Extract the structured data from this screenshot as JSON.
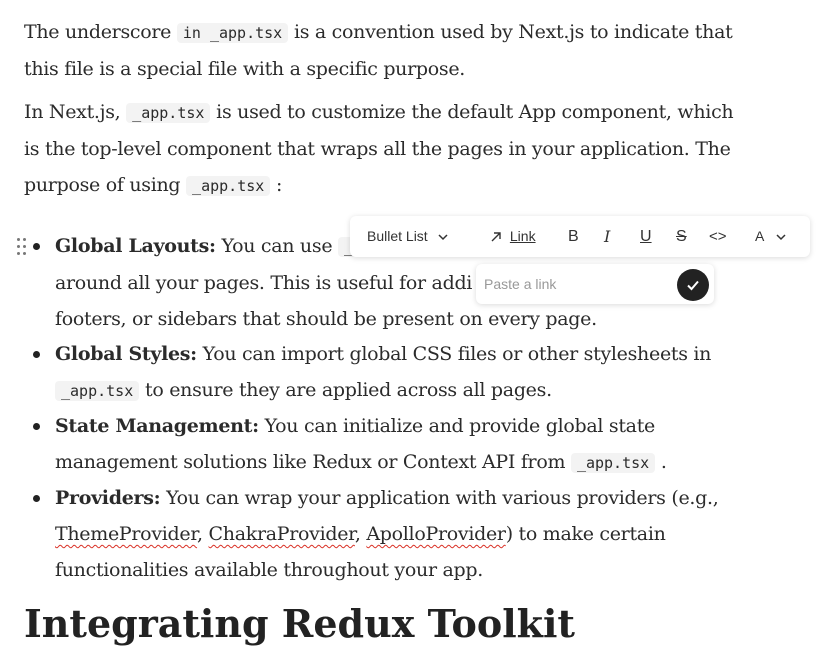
{
  "paragraphs": {
    "p1_a": "The underscore ",
    "p1_code": "in _app.tsx",
    "p1_b": " is a convention used by Next.js to indicate that this file is a special file with a specific purpose.",
    "p2_a": "In Next.js, ",
    "p2_code": "_app.tsx",
    "p2_b": " is used to customize the default App component, which is the top-level component that wraps all the pages in your application. The purpose of using ",
    "p2_code2": "_app.tsx",
    "p2_c": " :"
  },
  "list": {
    "item1": {
      "title": "Global Layouts:",
      "line1": " You can use ",
      "code_fragment": "_a",
      "line2": "around all your pages. This is useful for addi",
      "line3": "footers, or sidebars that should be present on every page."
    },
    "item2": {
      "title": "Global Styles:",
      "text_a": " You can import global CSS files or other stylesheets in",
      "code": "_app.tsx",
      "text_b": " to ensure they are applied across all pages."
    },
    "item3": {
      "title": "State Management:",
      "text_a": " You can initialize and provide global state",
      "text_b": "management solutions like Redux or Context API from ",
      "code": "_app.tsx",
      "text_c": " ."
    },
    "item4": {
      "title": "Providers:",
      "text_a": " You can wrap your application with various providers (e.g.,",
      "p1": "ThemeProvider",
      "sep1": ", ",
      "p2": "ChakraProvider",
      "sep2": ", ",
      "p3": "ApolloProvider",
      "text_b": ") to make certain",
      "text_c": "functionalities available throughout your app."
    }
  },
  "toolbar": {
    "block_type": "Bullet List",
    "link_label": "Link",
    "bold": "B",
    "italic": "I",
    "underline": "U",
    "strike": "S",
    "code": "<>",
    "color": "A"
  },
  "link_popup": {
    "placeholder": "Paste a link"
  },
  "heading_partial": "Integrating Redux Toolkit"
}
